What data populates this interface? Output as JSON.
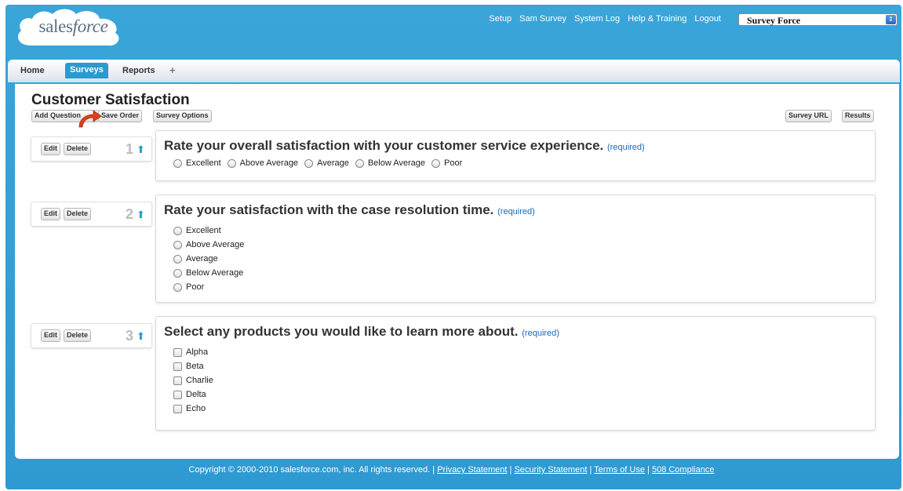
{
  "header": {
    "logo_text_main": "sales",
    "logo_text_italic": "force",
    "links": [
      "Setup",
      "Sam Survey",
      "System Log",
      "Help & Training",
      "Logout"
    ],
    "app_selector": "Survey Force"
  },
  "tabs": [
    {
      "label": "Home",
      "active": false
    },
    {
      "label": "Surveys",
      "active": true
    },
    {
      "label": "Reports",
      "active": false
    },
    {
      "label": "+",
      "active": false
    }
  ],
  "page": {
    "title": "Customer Satisfaction",
    "toolbar": {
      "add_question": "Add Question",
      "save_order": "Save Order",
      "survey_options": "Survey Options",
      "survey_url": "Survey URL",
      "results": "Results"
    }
  },
  "question_controls": {
    "edit": "Edit",
    "delete": "Delete"
  },
  "questions": [
    {
      "number": "1",
      "title": "Rate your overall satisfaction with your customer service experience.",
      "required": "(required)",
      "layout": "horizontal",
      "input": "radio",
      "options": [
        "Excellent",
        "Above Average",
        "Average",
        "Below Average",
        "Poor"
      ]
    },
    {
      "number": "2",
      "title": "Rate your satisfaction with the case resolution time.",
      "required": "(required)",
      "layout": "vertical",
      "input": "radio",
      "options": [
        "Excellent",
        "Above Average",
        "Average",
        "Below Average",
        "Poor"
      ]
    },
    {
      "number": "3",
      "title": "Select any products you would like to learn more about.",
      "required": "(required)",
      "layout": "vertical",
      "input": "checkbox",
      "options": [
        "Alpha",
        "Beta",
        "Charlie",
        "Delta",
        "Echo"
      ]
    }
  ],
  "footer": {
    "copyright": "Copyright © 2000-2010 salesforce.com, inc. All rights reserved. |",
    "links": [
      "Privacy Statement",
      "Security Statement",
      "Terms of Use",
      "508 Compliance"
    ]
  },
  "colors": {
    "frame_blue": "#2f9ad2",
    "active_tab": "#2a9ad3",
    "required_link": "#1a6ab8",
    "pointer_arrow": "#e0401c"
  }
}
